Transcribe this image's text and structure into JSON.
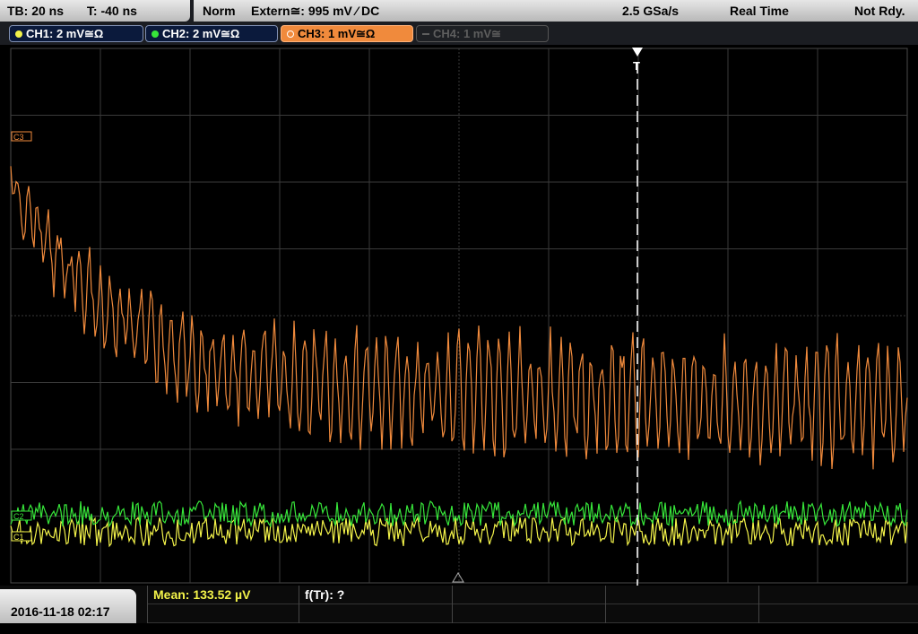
{
  "timebase": {
    "tb": "TB: 20 ns",
    "t": "T: -40 ns"
  },
  "trigger": {
    "mode": "Norm",
    "source": "Extern≅: 995 mV ⁄ DC",
    "sample_rate": "2.5 GSa/s",
    "acq_mode": "Real Time",
    "status": "Not Rdy."
  },
  "channels": [
    {
      "label": "CH1: 2 mV≅Ω",
      "color": "#f3f34a"
    },
    {
      "label": "CH2: 2 mV≅Ω",
      "color": "#37e63a"
    },
    {
      "label": "CH3: 1 mV≅Ω",
      "color": "#f08a3c"
    },
    {
      "label": "CH4: 1 mV≅",
      "color": "#5e5e5e"
    }
  ],
  "markers": {
    "trigger": "T",
    "ch3": "C3",
    "ch2": "C2",
    "ch1": "C1"
  },
  "measurements": {
    "mean": "Mean: 133.52 µV",
    "ftr": "f(Tr): ?"
  },
  "timestamp": "2016-11-18 02:17",
  "colors": {
    "grid": "#3a3a3a",
    "ch1": "#f3f34a",
    "ch2": "#37e63a",
    "ch3": "#f08a3c"
  }
}
